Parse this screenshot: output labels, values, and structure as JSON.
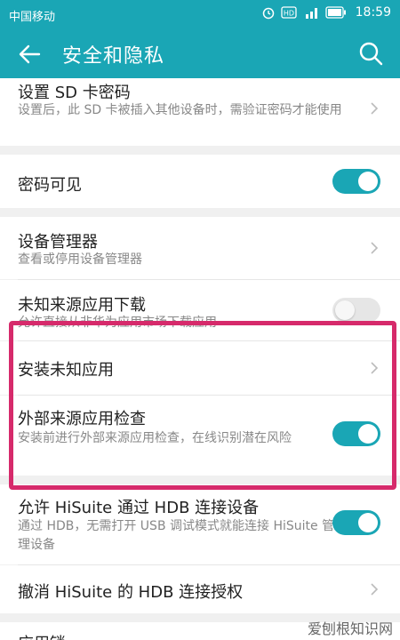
{
  "status_bar": {
    "carrier": "中国移动",
    "time": "18:59",
    "icons": [
      "alarm-icon",
      "hd-icon",
      "signal-4g-icon",
      "battery-icon"
    ]
  },
  "app_bar": {
    "title": "安全和隐私",
    "back_icon": "back-arrow-icon",
    "search_icon": "search-icon"
  },
  "settings": {
    "sd_password": {
      "title": "设置 SD 卡密码",
      "subtitle": "设置后，此 SD 卡被插入其他设备时，需验证密码才能使用"
    },
    "password_visible": {
      "title": "密码可见",
      "enabled": true
    },
    "device_admin": {
      "title": "设备管理器",
      "subtitle": "查看或停用设备管理器"
    },
    "unknown_sources": {
      "title": "未知来源应用下载",
      "subtitle": "允许直接从非华为应用市场下载应用",
      "enabled": false
    },
    "install_unknown": {
      "title": "安装未知应用"
    },
    "external_check": {
      "title": "外部来源应用检查",
      "subtitle": "安装前进行外部来源应用检查，在线识别潜在风险",
      "enabled": true
    },
    "hisuite_hdb": {
      "title": "允许 HiSuite 通过 HDB 连接设备",
      "subtitle": "通过 HDB，无需打开 USB 调试模式就能连接 HiSuite 管理设备",
      "enabled": true
    },
    "revoke_hdb": {
      "title": "撤消 HiSuite 的 HDB 连接授权"
    },
    "partial_next": {
      "title": "应用锁"
    }
  },
  "watermark": "爱刨根知识网",
  "colors": {
    "accent": "#1aa6b5",
    "highlight": "#d62a6b"
  }
}
